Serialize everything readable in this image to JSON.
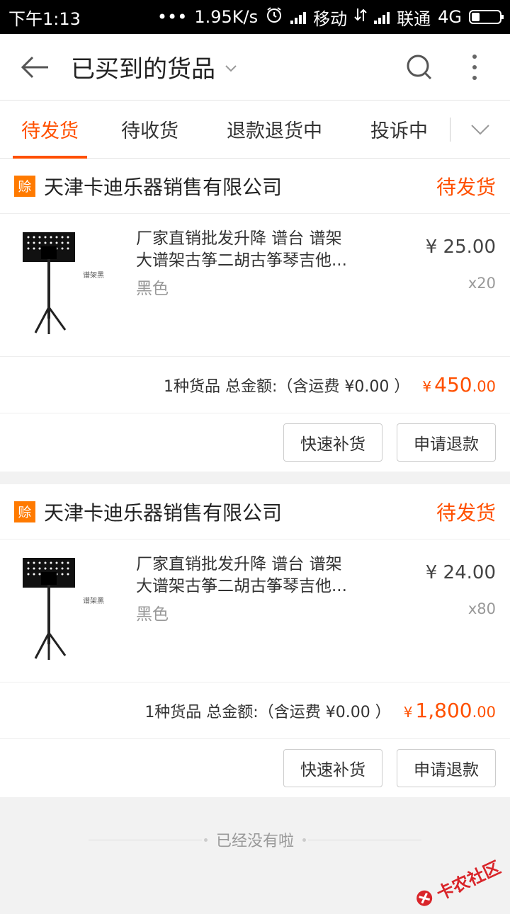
{
  "status_bar": {
    "time": "下午1:13",
    "dots": "•••",
    "speed": "1.95K/s",
    "carrier1": "移动",
    "carrier2": "联通",
    "network": "4G"
  },
  "app_bar": {
    "title": "已买到的货品"
  },
  "tabs": [
    {
      "label": "待发货"
    },
    {
      "label": "待收货"
    },
    {
      "label": "退款退货中"
    },
    {
      "label": "投诉中"
    }
  ],
  "orders": [
    {
      "badge": "赊",
      "shop": "天津卡迪乐器销售有限公司",
      "status": "待发货",
      "product_title_line1": "厂家直销批发升降 谱台 谱架",
      "product_title_line2": "大谱架古筝二胡古筝琴吉他...",
      "spec": "黑色",
      "unit_price": "¥ 25.00",
      "qty": "x20",
      "summary_text": "1种货品 总金额:（含运费 ¥0.00 ）",
      "total_currency": "¥",
      "total_int": "450",
      "total_dec": ".00",
      "btn_restock": "快速补货",
      "btn_refund": "申请退款",
      "image_label": "谱架黑"
    },
    {
      "badge": "赊",
      "shop": "天津卡迪乐器销售有限公司",
      "status": "待发货",
      "product_title_line1": "厂家直销批发升降 谱台 谱架",
      "product_title_line2": "大谱架古筝二胡古筝琴吉他...",
      "spec": "黑色",
      "unit_price": "¥ 24.00",
      "qty": "x80",
      "summary_text": "1种货品 总金额:（含运费 ¥0.00 ）",
      "total_currency": "¥",
      "total_int": "1,800",
      "total_dec": ".00",
      "btn_restock": "快速补货",
      "btn_refund": "申请退款",
      "image_label": "谱架黑"
    }
  ],
  "footer": {
    "end_text": "已经没有啦"
  },
  "watermark": {
    "text": "卡农社区"
  },
  "colors": {
    "accent": "#ff5000",
    "badge": "#ff7a00"
  }
}
